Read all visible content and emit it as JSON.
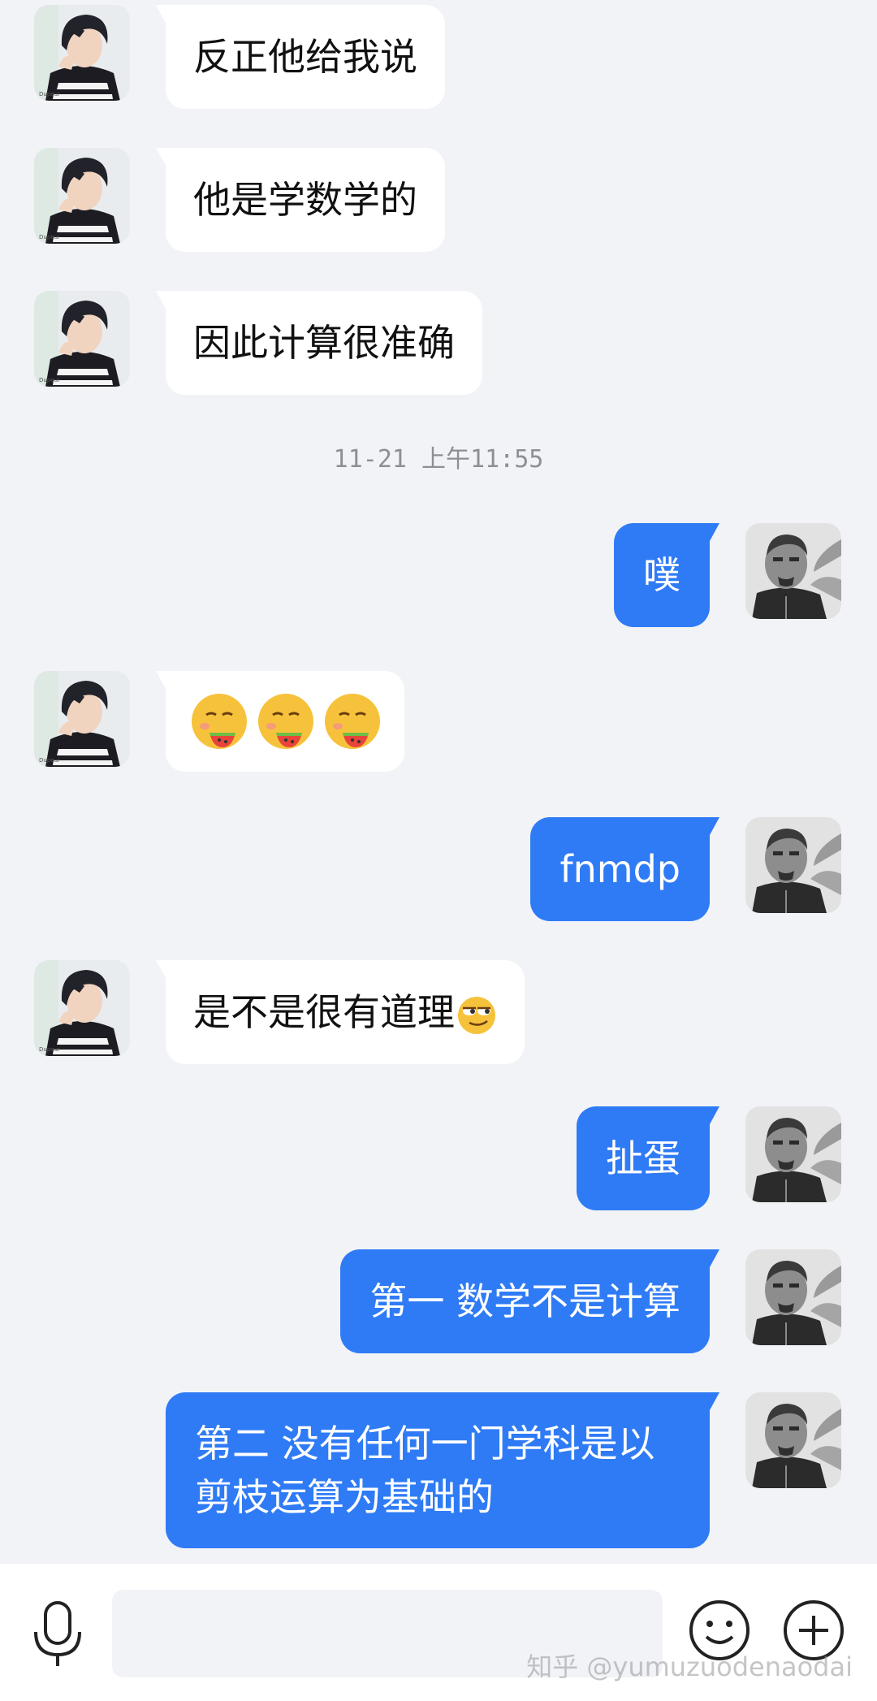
{
  "messages": [
    {
      "side": "in",
      "text": "反正他给我说"
    },
    {
      "side": "in",
      "text": "他是学数学的"
    },
    {
      "side": "in",
      "text": "因此计算很准确"
    },
    {
      "side": "out",
      "text": "噗"
    },
    {
      "side": "in",
      "emoji": "watermelon-eating-face-emoji",
      "count": 3
    },
    {
      "side": "out",
      "text": "fnmdp"
    },
    {
      "side": "in",
      "text": "是不是很有道理",
      "trailing_emoji": "smirk-face-emoji"
    },
    {
      "side": "out",
      "text": "扯蛋"
    },
    {
      "side": "out",
      "text": "第一 数学不是计算"
    },
    {
      "side": "out",
      "text": "第二 没有任何一门学科是以剪枝运算为基础的"
    }
  ],
  "timestamp": "11-21 上午11:55",
  "input_bar": {
    "icons": [
      "microphone-icon",
      "emoji-smile-icon",
      "plus-icon"
    ]
  },
  "watermark": "知乎 @yumuzuodenaodai",
  "colors": {
    "background": "#f2f3f7",
    "incoming_bubble": "#ffffff",
    "outgoing_bubble": "#2f7bf5",
    "timestamp": "#8c8f96"
  }
}
